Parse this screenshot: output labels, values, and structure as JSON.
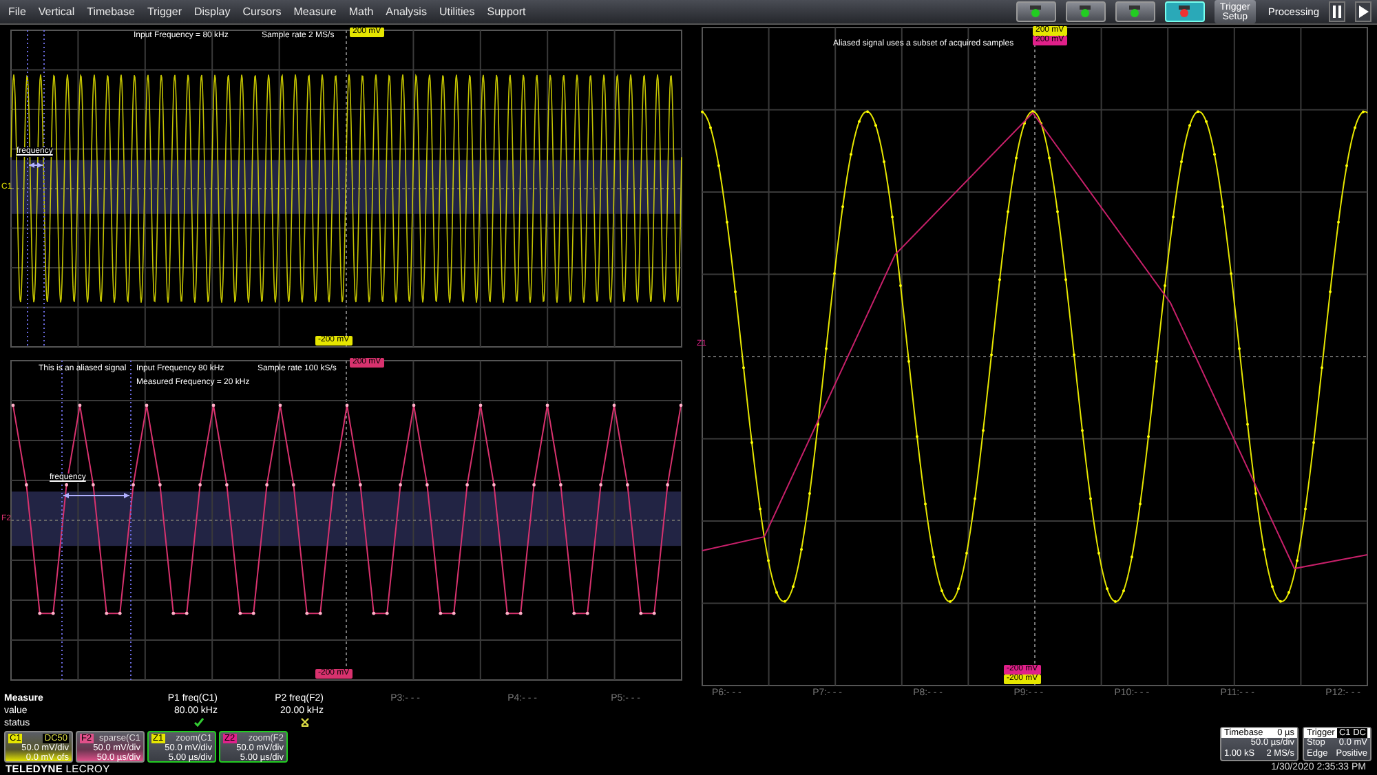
{
  "menu": [
    "File",
    "Vertical",
    "Timebase",
    "Trigger",
    "Display",
    "Cursors",
    "Measure",
    "Math",
    "Analysis",
    "Utilities",
    "Support"
  ],
  "toolbar": {
    "mode_buttons": [
      {
        "selected": false
      },
      {
        "selected": false
      },
      {
        "selected": false
      },
      {
        "selected": true
      }
    ],
    "trigger_setup": "Trigger Setup",
    "processing": "Processing"
  },
  "panels": [
    {
      "kind": "dense",
      "channel": "C1",
      "top_marker": "200 mV",
      "bottom_marker": "-200 mV",
      "cursor_label": "frequency",
      "notes": [
        "Input Frequency = 80 kHz",
        "Sample rate 2 MS/s"
      ]
    },
    {
      "kind": "aliased",
      "channel": "F2",
      "top_marker": "200 mV",
      "bottom_marker": "-200 mV",
      "cursor_label": "frequency",
      "notes": [
        "This is an aliased signal",
        "Input Frequency 80 kHz",
        "Measured Frequency = 20 kHz",
        "Sample rate 100 kS/s"
      ]
    }
  ],
  "zoom_panel": {
    "note": "Aliased signal uses a subset of acquired samples",
    "channel": "Z1",
    "top_markers": [
      {
        "text": "200 mV",
        "color": "#e6e600"
      },
      {
        "text": "200 mV",
        "color": "#e0208a"
      }
    ],
    "bottom_markers": [
      {
        "text": "-200 mV",
        "color": "#e0208a"
      },
      {
        "text": "-200 mV",
        "color": "#e6e600"
      }
    ],
    "params": [
      "P6:- - -",
      "P7:- - -",
      "P8:- - -",
      "P9:- - -",
      "P10:- - -",
      "P11:- - -",
      "P12:- - -"
    ]
  },
  "measure": {
    "labels": [
      "Measure",
      "value",
      "status"
    ],
    "params": [
      {
        "name": "P1 freq(C1)",
        "value": "80.00 kHz",
        "passed": true
      },
      {
        "name": "P2 freq(F2)",
        "value": "20.00 kHz",
        "passed": false
      },
      {
        "name": "P3:- - -"
      },
      {
        "name": "P4:- - -"
      },
      {
        "name": "P5:- - -"
      }
    ]
  },
  "descriptors": [
    {
      "tag": "C1",
      "color": "#e6e600",
      "title": "DC50",
      "kind": "coupling",
      "lines": [
        "50.0 mV/div",
        "0.0 mV ofs"
      ]
    },
    {
      "tag": "F2",
      "color": "#e0508a",
      "title": "sparse(C1",
      "kind": "math",
      "lines": [
        "50.0 mV/div",
        "50.0 µs/div"
      ]
    },
    {
      "tag": "Z1",
      "color": "#e6e600",
      "title": "zoom(C1",
      "kind": "zoom",
      "lines": [
        "50.0 mV/div",
        "5.00 µs/div"
      ]
    },
    {
      "tag": "Z2",
      "color": "#e0208a",
      "title": "zoom(F2",
      "kind": "zoom",
      "lines": [
        "50.0 mV/div",
        "5.00 µs/div"
      ]
    }
  ],
  "logo": {
    "brand": "TELEDYNE",
    "sub": "LECROY"
  },
  "timebase": {
    "title": "Timebase",
    "delay": "0 µs",
    "rows": [
      [
        "",
        "50.0 µs/div"
      ],
      [
        "1.00 kS",
        "2 MS/s"
      ]
    ]
  },
  "trigger": {
    "title": "Trigger",
    "source": "C1 DC",
    "rows": [
      [
        "Stop",
        "0.0 mV"
      ],
      [
        "Edge",
        "Positive"
      ]
    ]
  },
  "datetime": "1/30/2020 2:35:33 PM"
}
